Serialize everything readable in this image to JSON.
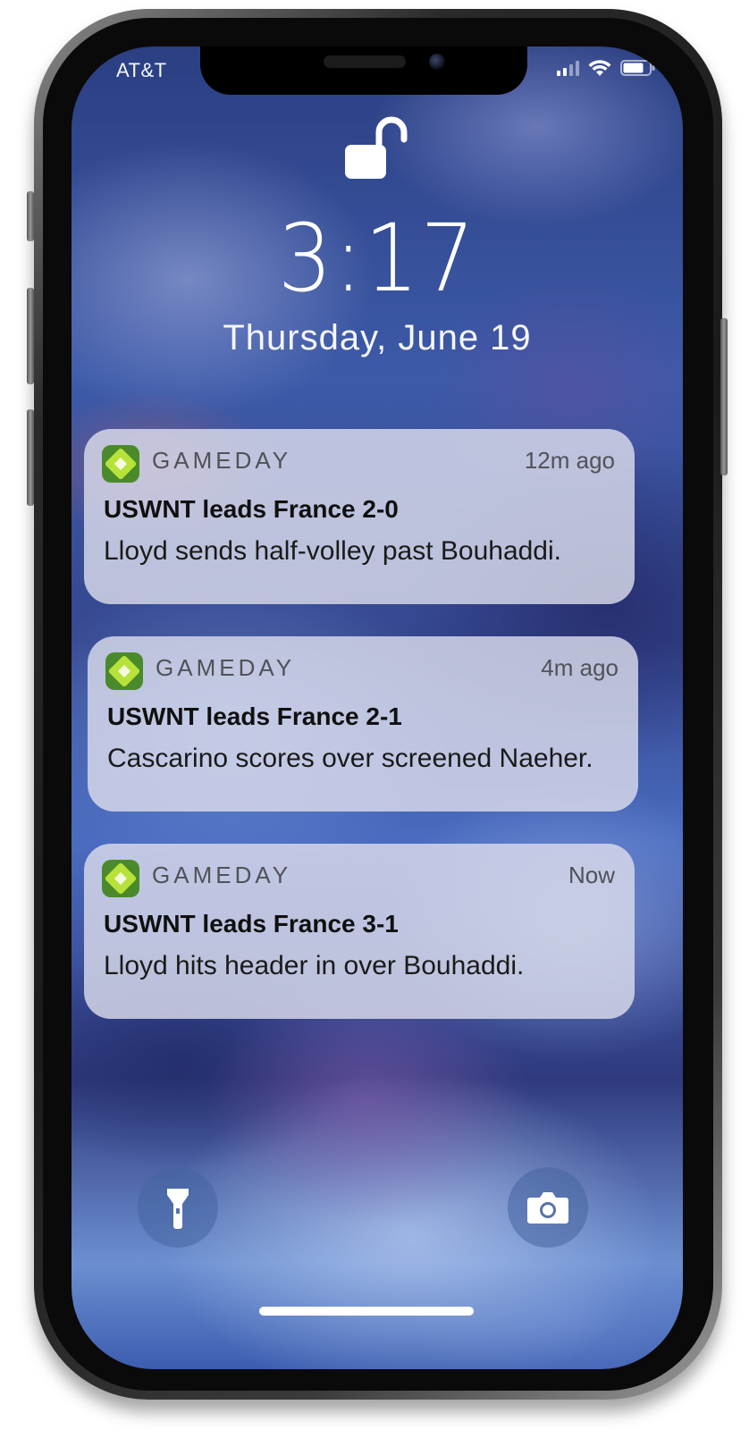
{
  "status_bar": {
    "carrier": "AT&T",
    "icons": [
      "signal-icon",
      "wifi-icon",
      "battery-icon"
    ]
  },
  "lock_screen": {
    "lock_icon": "unlocked-padlock-icon",
    "time": "3:17",
    "date": "Thursday, June 19"
  },
  "notifications": [
    {
      "app": "GAMEDAY",
      "time_ago": "12m ago",
      "title": "USWNT leads France 2-0",
      "body": "Lloyd sends half-volley past Bouhaddi."
    },
    {
      "app": "GAMEDAY",
      "time_ago": "4m ago",
      "title": "USWNT leads France 2-1",
      "body": "Cascarino scores over screened Naeher."
    },
    {
      "app": "GAMEDAY",
      "time_ago": "Now",
      "title": "USWNT leads France 3-1",
      "body": "Lloyd hits header in over Bouhaddi."
    }
  ],
  "quick_actions": {
    "left": "flashlight-icon",
    "right": "camera-icon"
  },
  "colors": {
    "app_icon_bg": "#4a8a2a",
    "app_icon_diamond": "#b6e23a",
    "notification_bg": "#dadcec"
  }
}
